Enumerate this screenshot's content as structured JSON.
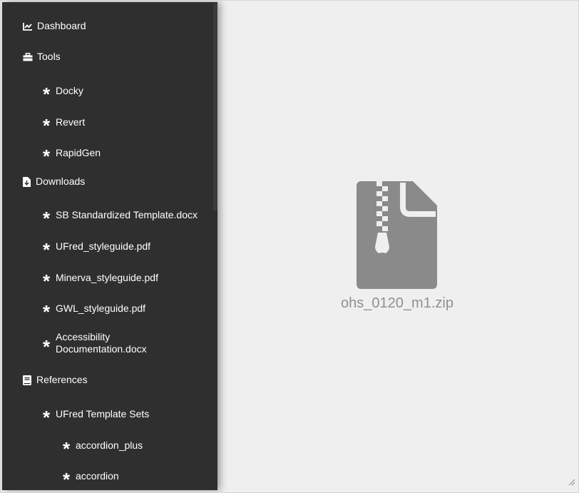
{
  "sidebar": {
    "items": [
      {
        "label": "Dashboard",
        "icon": "line-chart-icon"
      },
      {
        "label": "Tools",
        "icon": "toolbox-icon"
      },
      {
        "label": "Docky",
        "icon": "asterisk-icon"
      },
      {
        "label": "Revert",
        "icon": "asterisk-icon"
      },
      {
        "label": "RapidGen",
        "icon": "asterisk-icon"
      },
      {
        "label": "Downloads",
        "icon": "file-download-icon"
      },
      {
        "label": "SB Standardized Template.docx",
        "icon": "asterisk-icon"
      },
      {
        "label": "UFred_styleguide.pdf",
        "icon": "asterisk-icon"
      },
      {
        "label": "Minerva_styleguide.pdf",
        "icon": "asterisk-icon"
      },
      {
        "label": "GWL_styleguide.pdf",
        "icon": "asterisk-icon"
      },
      {
        "label": "Accessibility Documentation.docx",
        "icon": "asterisk-icon"
      },
      {
        "label": "References",
        "icon": "book-icon"
      },
      {
        "label": "UFred Template Sets",
        "icon": "asterisk-icon"
      },
      {
        "label": "accordion_plus",
        "icon": "asterisk-icon"
      },
      {
        "label": "accordion",
        "icon": "asterisk-icon"
      }
    ]
  },
  "main": {
    "file_icon": "zip-file-icon",
    "file_name": "ohs_0120_m1.zip"
  },
  "colors": {
    "sidebar_bg": "#2f2f2f",
    "main_bg": "#efefef",
    "icon_gray": "#8a8a8a",
    "text_white": "#ffffff"
  }
}
